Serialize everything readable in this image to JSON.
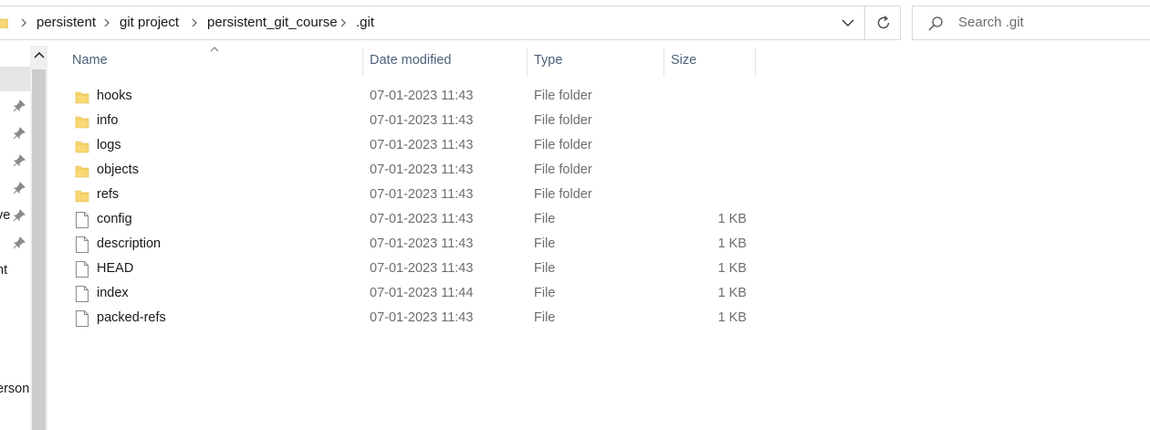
{
  "address_bar": {
    "breadcrumbs": [
      "persistent",
      "git project",
      "persistent_git_course",
      ".git"
    ]
  },
  "search": {
    "placeholder": "Search .git"
  },
  "nav_pane": {
    "partial_labels": [
      "ve",
      "nt",
      "erson"
    ]
  },
  "columns": {
    "name": "Name",
    "date_modified": "Date modified",
    "type": "Type",
    "size": "Size"
  },
  "files": [
    {
      "name": "hooks",
      "date": "07-01-2023 11:43",
      "type": "File folder",
      "size": "",
      "icon": "folder-icon"
    },
    {
      "name": "info",
      "date": "07-01-2023 11:43",
      "type": "File folder",
      "size": "",
      "icon": "folder-icon"
    },
    {
      "name": "logs",
      "date": "07-01-2023 11:43",
      "type": "File folder",
      "size": "",
      "icon": "folder-icon"
    },
    {
      "name": "objects",
      "date": "07-01-2023 11:43",
      "type": "File folder",
      "size": "",
      "icon": "folder-icon"
    },
    {
      "name": "refs",
      "date": "07-01-2023 11:43",
      "type": "File folder",
      "size": "",
      "icon": "folder-icon"
    },
    {
      "name": "config",
      "date": "07-01-2023 11:43",
      "type": "File",
      "size": "1 KB",
      "icon": "file-icon"
    },
    {
      "name": "description",
      "date": "07-01-2023 11:43",
      "type": "File",
      "size": "1 KB",
      "icon": "file-icon"
    },
    {
      "name": "HEAD",
      "date": "07-01-2023 11:43",
      "type": "File",
      "size": "1 KB",
      "icon": "file-icon"
    },
    {
      "name": "index",
      "date": "07-01-2023 11:44",
      "type": "File",
      "size": "1 KB",
      "icon": "file-icon"
    },
    {
      "name": "packed-refs",
      "date": "07-01-2023 11:43",
      "type": "File",
      "size": "1 KB",
      "icon": "file-icon"
    }
  ],
  "colors": {
    "folder": "#f8d775",
    "header_text": "#4c607a",
    "secondary_text": "#6d6d6d"
  }
}
